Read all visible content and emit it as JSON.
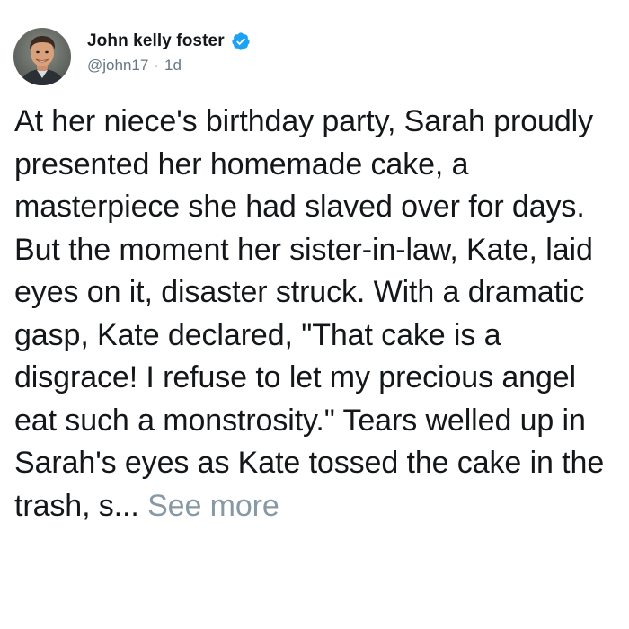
{
  "author": {
    "display_name": "John kelly foster",
    "handle": "@john17",
    "separator": "·",
    "timestamp": "1d",
    "verified": true,
    "verified_color": "#1da1f2"
  },
  "avatar": {
    "icon": "profile-photo"
  },
  "tweet": {
    "text": "At her niece's birthday party, Sarah proudly presented her homemade cake, a masterpiece she had slaved over for days. But the moment her sister-in-law, Kate, laid eyes on it, disaster struck. With a dramatic gasp, Kate declared, \"That cake is a disgrace! I refuse to let my precious angel eat such a monstrosity.\" Tears welled up in Sarah's eyes as Kate tossed the cake in the trash, s...",
    "see_more_label": "See more"
  },
  "colors": {
    "text": "#14171a",
    "secondary": "#657786",
    "see_more": "#8899a6"
  }
}
